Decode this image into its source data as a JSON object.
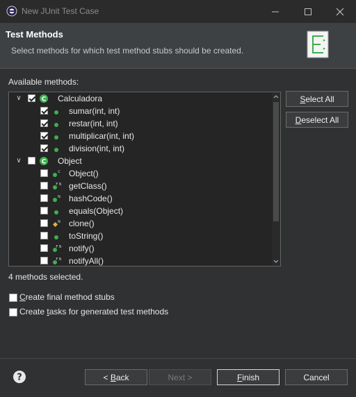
{
  "window": {
    "title": "New JUnit Test Case"
  },
  "header": {
    "title": "Test Methods",
    "description": "Select methods for which test method stubs should be created."
  },
  "tree": {
    "label": "Available methods:",
    "nodes": [
      {
        "label": "Calculadora",
        "checked": true,
        "expanded": true,
        "icon": "class-icon",
        "children": [
          {
            "label": "sumar(int, int)",
            "checked": true,
            "icon": "public-method-icon"
          },
          {
            "label": "restar(int, int)",
            "checked": true,
            "icon": "public-method-icon"
          },
          {
            "label": "multiplicar(int, int)",
            "checked": true,
            "icon": "public-method-icon"
          },
          {
            "label": "division(int, int)",
            "checked": true,
            "icon": "public-method-icon"
          }
        ]
      },
      {
        "label": "Object",
        "checked": false,
        "expanded": true,
        "icon": "class-icon",
        "children": [
          {
            "label": "Object()",
            "checked": false,
            "icon": "constructor-icon"
          },
          {
            "label": "getClass()",
            "checked": false,
            "icon": "final-native-method-icon"
          },
          {
            "label": "hashCode()",
            "checked": false,
            "icon": "native-method-icon"
          },
          {
            "label": "equals(Object)",
            "checked": false,
            "icon": "public-method-icon"
          },
          {
            "label": "clone()",
            "checked": false,
            "icon": "protected-native-method-icon"
          },
          {
            "label": "toString()",
            "checked": false,
            "icon": "public-method-icon"
          },
          {
            "label": "notify()",
            "checked": false,
            "icon": "final-native-method-icon"
          },
          {
            "label": "notifyAll()",
            "checked": false,
            "icon": "final-native-method-icon"
          }
        ]
      }
    ]
  },
  "side_buttons": {
    "select_all": {
      "mnemonic": "S",
      "rest": "elect All"
    },
    "deselect_all": {
      "mnemonic": "D",
      "rest": "eselect All"
    }
  },
  "status": "4 methods selected.",
  "options": {
    "final_stubs": {
      "checked": false,
      "mnemonic": "C",
      "rest": "reate final method stubs"
    },
    "tasks": {
      "checked": false,
      "pre": "Create ",
      "mnemonic": "t",
      "rest": "asks for generated test methods"
    }
  },
  "footer": {
    "back": {
      "pre": "< ",
      "mnemonic": "B",
      "rest": "ack"
    },
    "next": {
      "label": "Next >",
      "enabled": false
    },
    "finish": {
      "mnemonic": "F",
      "rest": "inish"
    },
    "cancel": {
      "label": "Cancel"
    }
  },
  "colors": {
    "background": "#2f3133",
    "header": "#3e4144",
    "method_green": "#3fae4f",
    "class_green": "#3fae4f",
    "protected_yellow": "#e0b23c"
  }
}
